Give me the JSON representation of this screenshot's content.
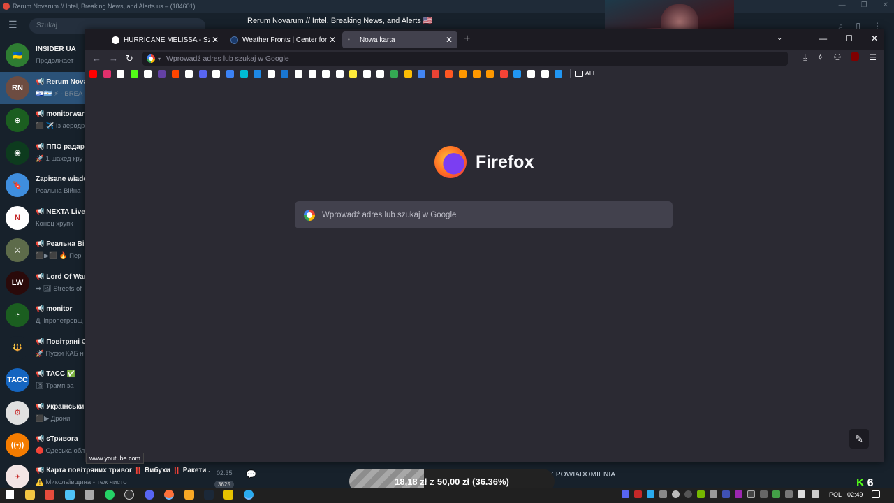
{
  "telegram": {
    "window_title": "Rerum Novarum // Intel, Breaking News, and Alerts us – (184601)",
    "search_placeholder": "Szukaj",
    "chat_title": "Rerum Novarum // Intel, Breaking News, and Alerts 🇺🇸",
    "chats": [
      {
        "name": "INSIDER UA",
        "preview": "Продолжает",
        "avatar_color": "#2e7d32",
        "avatar_text": "🇺🇦"
      },
      {
        "name": "📢 Rerum Nova",
        "preview": "🇮🇱🇦🇷 ⚡ - BREA",
        "avatar_color": "#6d4c41",
        "avatar_text": "RN",
        "active": true
      },
      {
        "name": "📢 monitorwar",
        "preview": "⬛ ✈️ Із аеродр",
        "avatar_color": "#1b5e20",
        "avatar_text": "⊕"
      },
      {
        "name": "📢 ППО радар",
        "preview": "🚀 1 шахед кру",
        "avatar_color": "#0d3b1e",
        "avatar_text": "◉"
      },
      {
        "name": "Zapisane wiado",
        "preview": "Реальна Війна",
        "avatar_color": "#3f8ede",
        "avatar_text": "🔖"
      },
      {
        "name": "📢 NEXTA Live",
        "preview": "Конец хрупк",
        "avatar_color": "#ffffff",
        "avatar_text": "N"
      },
      {
        "name": "📢 Реальна Вій",
        "preview": "⬛▶⬛ 🔥 Пер",
        "avatar_color": "#5d6b4a",
        "avatar_text": "⚔"
      },
      {
        "name": "📢 Lord Of War",
        "preview": "➡ 🖼 Streets of",
        "avatar_color": "#2a0a0a",
        "avatar_text": "LW"
      },
      {
        "name": "📢 monitor",
        "preview": "Дніпропетровщ",
        "avatar_color": "#1b5e20",
        "avatar_text": "◔"
      },
      {
        "name": "📢 Повітряні Си",
        "preview": "🚀 Пуски КАБ н",
        "avatar_color": "#17212b",
        "avatar_text": "🔱"
      },
      {
        "name": "📢 ТАСС ✅",
        "preview": "🖼 Трамп за",
        "avatar_color": "#1565c0",
        "avatar_text": "ТАСС"
      },
      {
        "name": "📢 Українськи",
        "preview": "⬛▶ Дрони",
        "avatar_color": "#e0e0e0",
        "avatar_text": "⚙"
      },
      {
        "name": "📢 єТривога",
        "preview": "🔴 Одеська обл",
        "avatar_color": "#f57c00",
        "avatar_text": "((•))"
      }
    ],
    "bottom_chat": {
      "name": "📢 Карта повітряних тривог ‼️ Вибухи ‼️ Ракети ...",
      "preview": "⚠️ Миколаївщина - теж чисто",
      "time": "02:35",
      "unread": "3625"
    },
    "mute_label": "WYŁĄCZ POWIADOMIENIA"
  },
  "firefox": {
    "tabs": [
      {
        "title": "HURRICANE MELISSA - Szukaj w Google",
        "favicon_color": "#ffffff",
        "active": false
      },
      {
        "title": "Weather Fronts | Center for Science Education",
        "favicon_color": "#1a3a6b",
        "active": false
      },
      {
        "title": "Nowa karta",
        "favicon_color": "#42414d",
        "active": true
      }
    ],
    "url_placeholder": "Wprowadź adres lub szukaj w Google",
    "bookmarks_all_label": "ALL",
    "bookmark_colors": [
      "#ff0000",
      "#e1306c",
      "#ffffff",
      "#53fc18",
      "#ffffff",
      "#6441a5",
      "#ff4500",
      "#ffffff",
      "#5865f2",
      "#ffffff",
      "#3b82f6",
      "#00bcd4",
      "#1e88e5",
      "#ffffff",
      "#1976d2",
      "#ffffff",
      "#ffffff",
      "#ffffff",
      "#ffffff",
      "#ffeb3b",
      "#ffffff",
      "#ffffff",
      "#34a853",
      "#fbbc05",
      "#4285f4",
      "#ea4335",
      "#ff5722",
      "#ff9800",
      "#ff9800",
      "#ff9800",
      "#f44336",
      "#2196f3",
      "#ffffff",
      "#ffffff",
      "#2196f3"
    ],
    "logo_text": "Firefox",
    "search_placeholder": "Wprowadź adres lub szukaj w Google",
    "status_url": "www.youtube.com"
  },
  "donation": {
    "raised": "18,18 zł",
    "separator": "z",
    "goal": "50,00 zł",
    "percent_text": "(36.36%)",
    "progress": 0.3636
  },
  "kick": {
    "label": "K",
    "count": "6"
  },
  "taskbar": {
    "lang": "POL",
    "time": "02:49"
  }
}
